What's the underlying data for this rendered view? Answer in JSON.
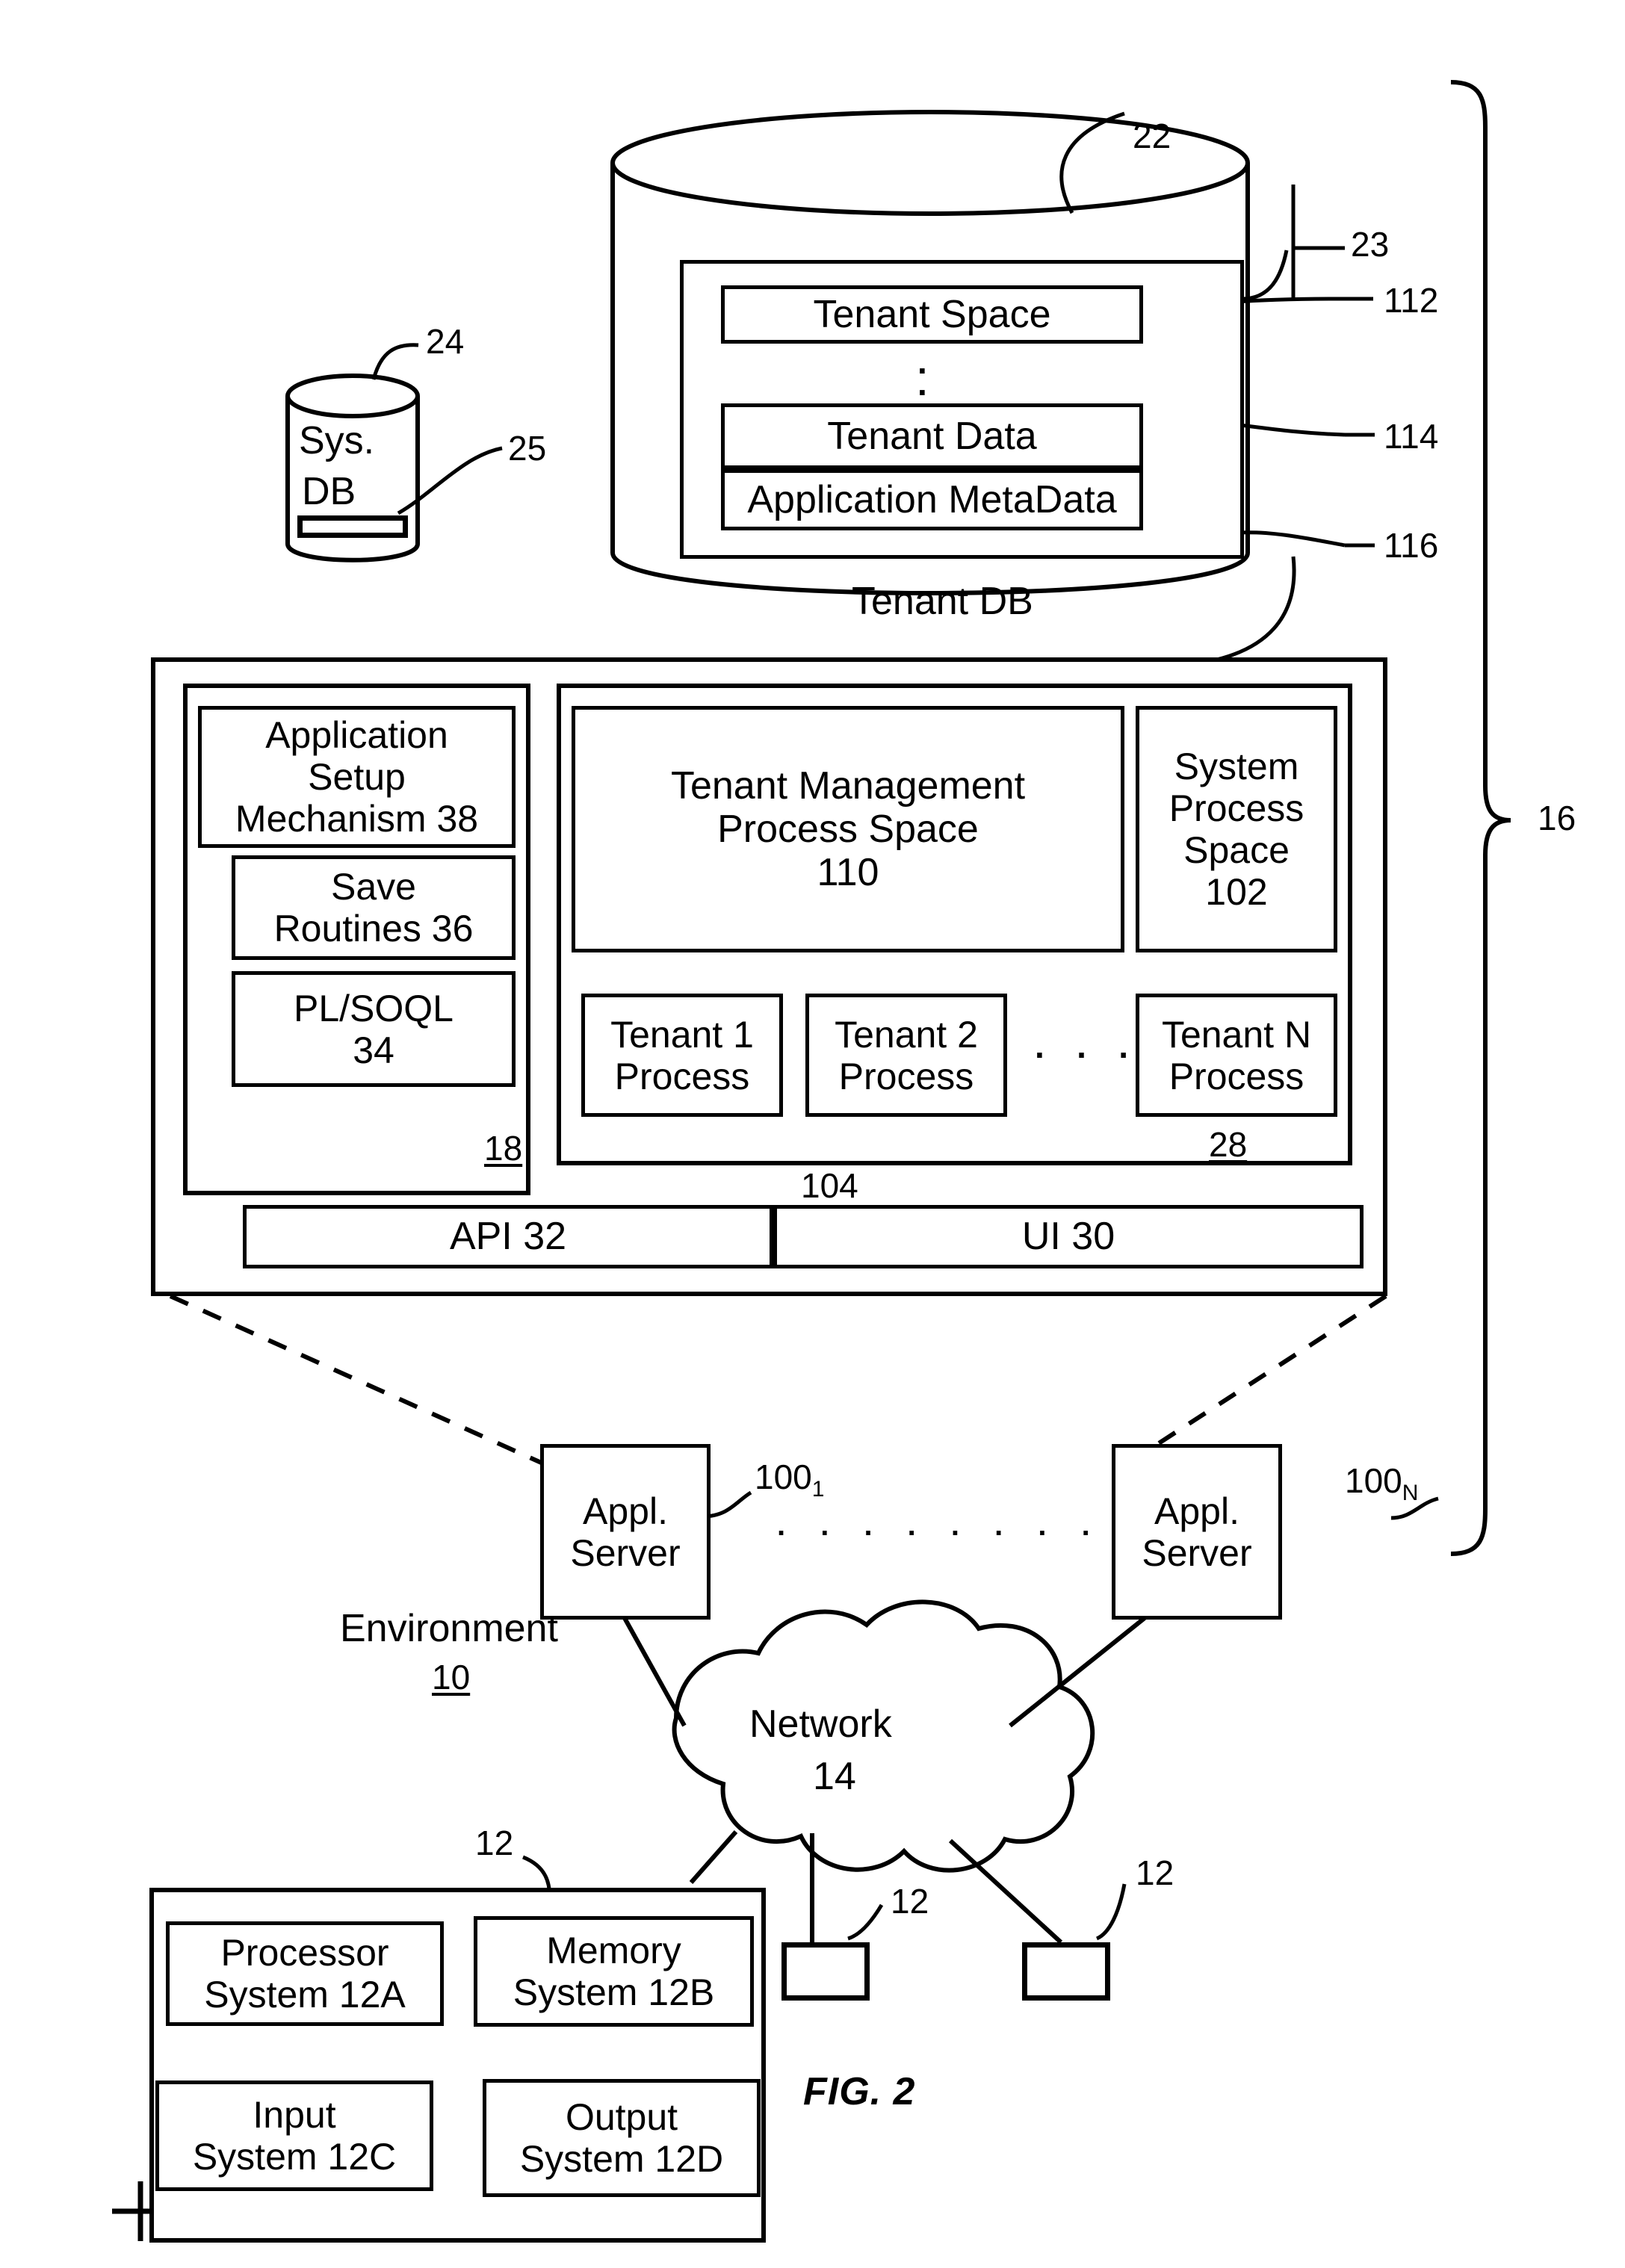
{
  "figure": {
    "label": "FIG. 2",
    "title": "Multi-tenant database system environment block diagram"
  },
  "tenant_db": {
    "cylinder_label": "Tenant DB",
    "ref_cylinder": "22",
    "ref_inner_container": "23",
    "items": [
      {
        "label": "Tenant Space",
        "ref": "112"
      },
      {
        "label": "Tenant Data",
        "ref": "114"
      },
      {
        "label": "Application MetaData",
        "ref": "116"
      }
    ],
    "vertical_ellipsis": "⋮"
  },
  "sys_db": {
    "line1": "Sys.",
    "line2": "DB",
    "ref_cylinder": "24",
    "ref_slot": "25"
  },
  "platform": {
    "ref_bracket": "16",
    "left_stack": {
      "ref": "18",
      "boxes": [
        {
          "label": "Application\nSetup\nMechanism 38"
        },
        {
          "label": "Save\nRoutines 36"
        },
        {
          "label": "PL/SOQL\n34"
        }
      ]
    },
    "right_stack": {
      "ref": "28",
      "tenant_management": "Tenant Management\nProcess Space\n110",
      "system_process": "System\nProcess\nSpace\n102",
      "processes": [
        {
          "label": "Tenant 1\nProcess"
        },
        {
          "label": "Tenant 2\nProcess"
        },
        {
          "label": "Tenant N\nProcess"
        }
      ],
      "process_ellipsis": "· · · ·",
      "ref_processes": "104"
    },
    "bottom_bar": [
      {
        "label": "API 32"
      },
      {
        "label": "UI 30"
      }
    ]
  },
  "app_servers": [
    {
      "label": "Appl.\nServer",
      "ref_base": "100",
      "ref_sub": "1"
    },
    {
      "label": "Appl.\nServer",
      "ref_base": "100",
      "ref_sub": "N"
    }
  ],
  "server_ellipsis": ". . . . . . . . .",
  "environment": {
    "label": "Environment",
    "ref": "10"
  },
  "network": {
    "line1": "Network",
    "line2": "14"
  },
  "user_system": {
    "ref": "12",
    "boxes": [
      {
        "label": "Processor\nSystem 12A"
      },
      {
        "label": "Memory\nSystem 12B"
      },
      {
        "label": "Input\nSystem 12C"
      },
      {
        "label": "Output\nSystem 12D"
      }
    ]
  },
  "other_user_systems": [
    {
      "ref": "12"
    },
    {
      "ref": "12"
    }
  ],
  "colors": {
    "ink": "#000000",
    "paper": "#ffffff"
  }
}
